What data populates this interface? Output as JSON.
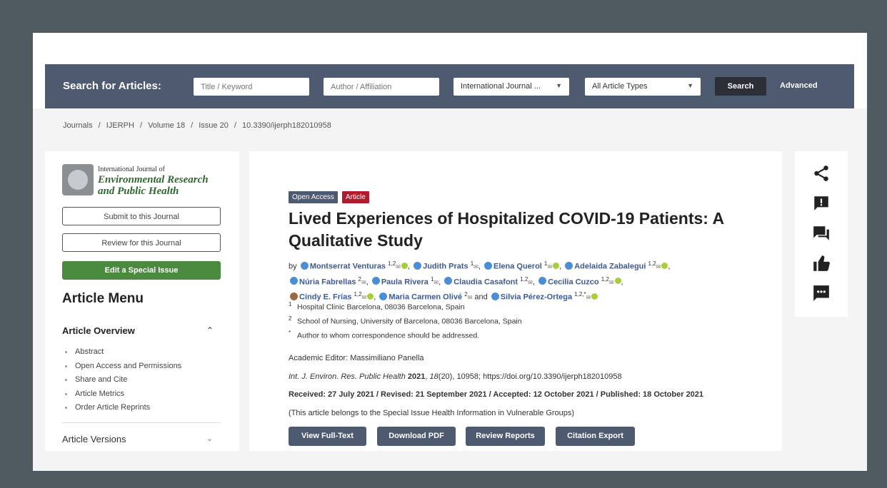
{
  "search": {
    "label": "Search for Articles:",
    "title_placeholder": "Title / Keyword",
    "author_placeholder": "Author / Affiliation",
    "journal_select": "International Journal ...",
    "type_select": "All Article Types",
    "search_button": "Search",
    "advanced_link": "Advanced"
  },
  "breadcrumb": [
    "Journals",
    "IJERPH",
    "Volume 18",
    "Issue 20",
    "10.3390/ijerph182010958"
  ],
  "breadcrumb_sep": "/",
  "sidebar": {
    "logo_line1": "International Journal of",
    "logo_line2": "Environmental Research",
    "logo_line3": "and Public Health",
    "submit_button": "Submit to this Journal",
    "review_button": "Review for this Journal",
    "special_issue_button": "Edit a Special Issue",
    "menu_heading": "Article Menu",
    "overview_heading": "Article Overview",
    "overview_items": [
      "Abstract",
      "Open Access and Permissions",
      "Share and Cite",
      "Article Metrics",
      "Order Article Reprints"
    ],
    "versions_heading": "Article Versions"
  },
  "article": {
    "badge_open_access": "Open Access",
    "badge_type": "Article",
    "title": "Lived Experiences of Hospitalized COVID-19 Patients: A Qualitative Study",
    "by": "by",
    "authors": [
      {
        "name": "Montserrat Venturas",
        "aff": "1,2"
      },
      {
        "name": "Judith Prats",
        "aff": "1"
      },
      {
        "name": "Elena Querol",
        "aff": "1"
      },
      {
        "name": "Adelaida Zabalegui",
        "aff": "1,2"
      },
      {
        "name": "Núria Fabrellas",
        "aff": "2"
      },
      {
        "name": "Paula Rivera",
        "aff": "1"
      },
      {
        "name": "Claudia Casafont",
        "aff": "1,2"
      },
      {
        "name": "Cecilia Cuzco",
        "aff": "1,2"
      },
      {
        "name": "Cindy E. Frías",
        "aff": "1,2"
      },
      {
        "name": "Maria Carmen Olivé",
        "aff": "2"
      },
      {
        "name": "Silvia Pérez-Ortega",
        "aff": "1,2,*"
      }
    ],
    "and": "and",
    "affiliations": [
      {
        "n": "1",
        "text": "Hospital Clinic Barcelona, 08036 Barcelona, Spain"
      },
      {
        "n": "2",
        "text": "School of Nursing, University of Barcelona, 08036 Barcelona, Spain"
      },
      {
        "n": "*",
        "text": "Author to whom correspondence should be addressed."
      }
    ],
    "editor": "Academic Editor: Massimiliano Panella",
    "citation_journal": "Int. J. Environ. Res. Public Health",
    "citation_year": "2021",
    "citation_volume": "18",
    "citation_rest": "(20), 10958; https://doi.org/10.3390/ijerph182010958",
    "dates": "Received: 27 July 2021 / Revised: 21 September 2021 / Accepted: 12 October 2021 / Published: 18 October 2021",
    "special_issue_note": "(This article belongs to the Special Issue Health Information in Vulnerable Groups)",
    "buttons": [
      "View Full-Text",
      "Download PDF",
      "Review Reports",
      "Citation Export"
    ]
  },
  "colors": {
    "nav": "#4e5a70",
    "badge_open_access": "#4e5a70",
    "badge_article": "#b01c2e",
    "green": "#4a8a3e"
  },
  "right_icons": [
    "share-icon",
    "report-icon",
    "comments-icon",
    "endorse-icon",
    "chat-icon"
  ]
}
